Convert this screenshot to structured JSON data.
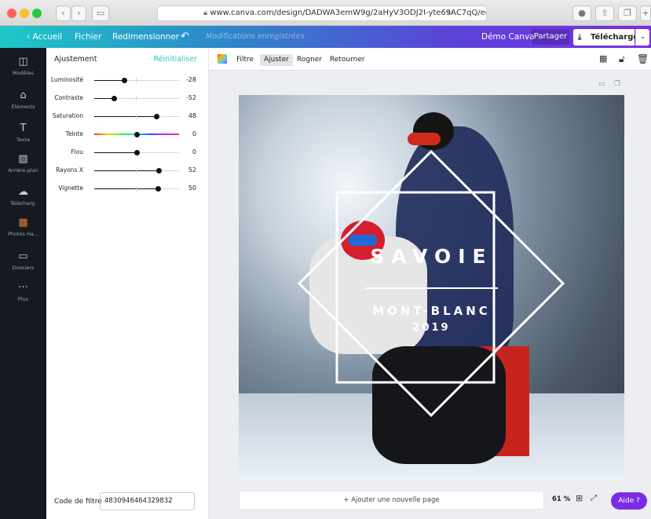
{
  "browser": {
    "url": "www.canva.com/design/DADWA3emW9g/2aHyV3ODJ2I-yte69AC7qQ/edi",
    "back_icon": "chevron-left",
    "forward_icon": "chevron-right"
  },
  "header": {
    "home": "Accueil",
    "file": "Fichier",
    "resize": "Redimensionner",
    "undo_icon": "undo-arrow",
    "status": "Modifications enregistrées",
    "team": "Démo Canva",
    "share": "Partager",
    "download": "Télécharger"
  },
  "rail": {
    "items": [
      {
        "label": "Modèles",
        "icon": "templates-icon"
      },
      {
        "label": "Éléments",
        "icon": "elements-icon"
      },
      {
        "label": "Texte",
        "icon": "text-icon"
      },
      {
        "label": "Arrière-plan",
        "icon": "background-icon"
      },
      {
        "label": "Télécharg.",
        "icon": "upload-icon"
      },
      {
        "label": "Photos Ha...",
        "icon": "photos-icon"
      },
      {
        "label": "Dossiers",
        "icon": "folder-icon"
      },
      {
        "label": "Plus",
        "icon": "more-icon"
      }
    ]
  },
  "panel": {
    "title": "Ajustement",
    "reset": "Réinitialiser",
    "sliders": [
      {
        "label": "Luminosité",
        "value": "-28",
        "level": -28
      },
      {
        "label": "Contraste",
        "value": "-52",
        "level": -52
      },
      {
        "label": "Saturation",
        "value": "48",
        "level": 48
      },
      {
        "label": "Teinte",
        "value": "0",
        "level": 0
      },
      {
        "label": "Flou",
        "value": "0",
        "level": 0
      },
      {
        "label": "Rayons X",
        "value": "52",
        "level": 52
      },
      {
        "label": "Vignette",
        "value": "50",
        "level": 50
      }
    ],
    "filter_code_label": "Code de filtre",
    "filter_code": "4830946464329832"
  },
  "toolbar": {
    "filter": "Filtre",
    "adjust": "Ajuster",
    "crop": "Rogner",
    "flip": "Retourner"
  },
  "design": {
    "title": "SAVOIE",
    "subtitle": "MONT-BLANC",
    "year": "2019"
  },
  "footer": {
    "add_page": "+ Ajouter une nouvelle page",
    "zoom": "61 %",
    "help": "Aide ?"
  },
  "colors": {
    "accent_teal": "#2ec4c7",
    "header_gradient_start": "#1ec8c8",
    "header_gradient_end": "#7a2ee6",
    "help_purple": "#7d2ae8",
    "rail_dark": "#161a20"
  }
}
